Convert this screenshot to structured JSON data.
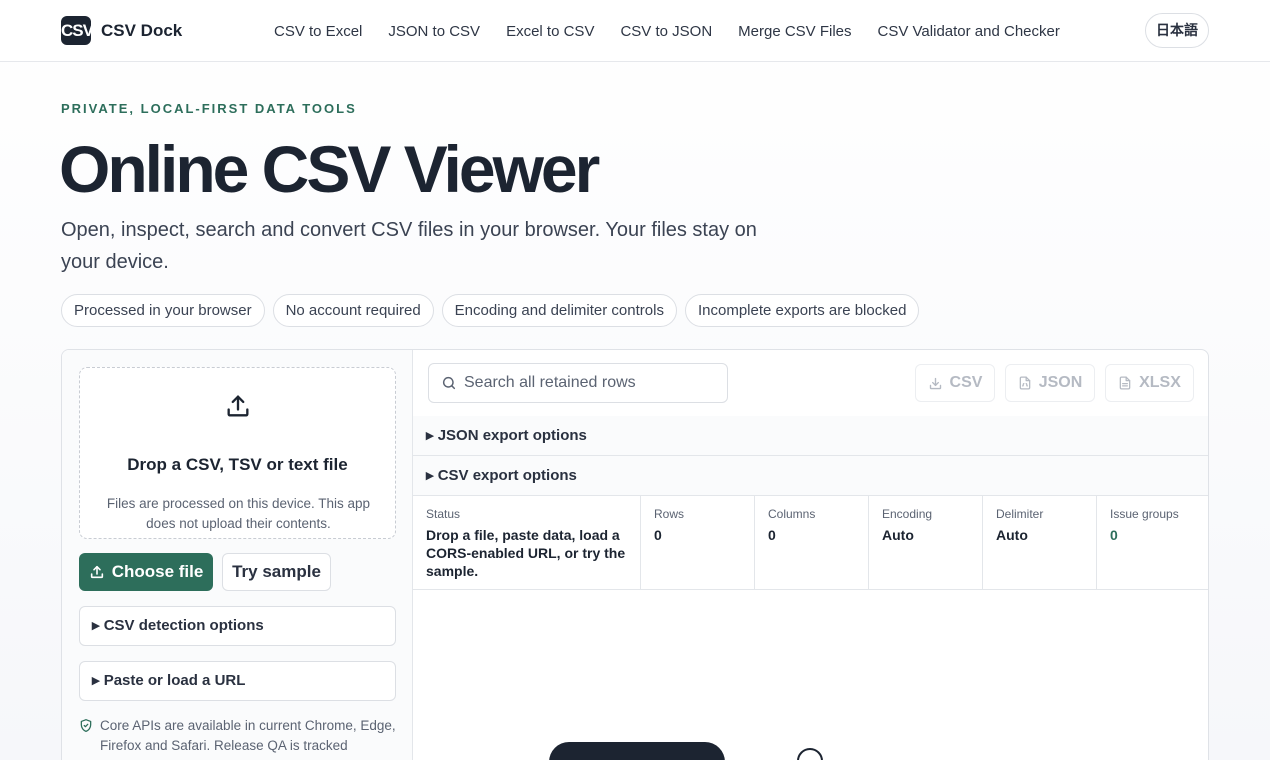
{
  "brand": {
    "logo_text": "CSV",
    "name": "CSV Dock"
  },
  "nav": [
    "CSV to Excel",
    "JSON to CSV",
    "Excel to CSV",
    "CSV to JSON",
    "Merge CSV Files",
    "CSV Validator and Checker"
  ],
  "lang": "日本語",
  "hero": {
    "kicker": "PRIVATE, LOCAL-FIRST DATA TOOLS",
    "title": "Online CSV Viewer",
    "lead": "Open, inspect, search and convert CSV files in your browser. Your files stay on your device."
  },
  "chips": [
    "Processed in your browser",
    "No account required",
    "Encoding and delimiter controls",
    "Incomplete exports are blocked"
  ],
  "drop": {
    "title": "Drop a CSV, TSV or text file",
    "note": "Files are processed on this device. This app does not upload their contents."
  },
  "buttons": {
    "choose": "Choose file",
    "sample": "Try sample"
  },
  "left_panels": {
    "detection": "▸ CSV detection options",
    "paste": "▸ Paste or load a URL"
  },
  "support_note": "Core APIs are available in current Chrome, Edge, Firefox and Safari. Release QA is tracked",
  "search": {
    "placeholder": "Search all retained rows"
  },
  "exports": {
    "csv": "CSV",
    "json": "JSON",
    "xlsx": "XLSX"
  },
  "options": {
    "json": "▸ JSON export options",
    "csv": "▸ CSV export options"
  },
  "stats": {
    "status": {
      "label": "Status",
      "value": "Drop a file, paste data, load a CORS-enabled URL, or try the sample."
    },
    "rows": {
      "label": "Rows",
      "value": "0"
    },
    "columns": {
      "label": "Columns",
      "value": "0"
    },
    "encoding": {
      "label": "Encoding",
      "value": "Auto"
    },
    "delimiter": {
      "label": "Delimiter",
      "value": "Auto"
    },
    "issues": {
      "label": "Issue groups",
      "value": "0"
    }
  },
  "colors": {
    "accent": "#2d6e5b",
    "ink": "#1c2431"
  }
}
